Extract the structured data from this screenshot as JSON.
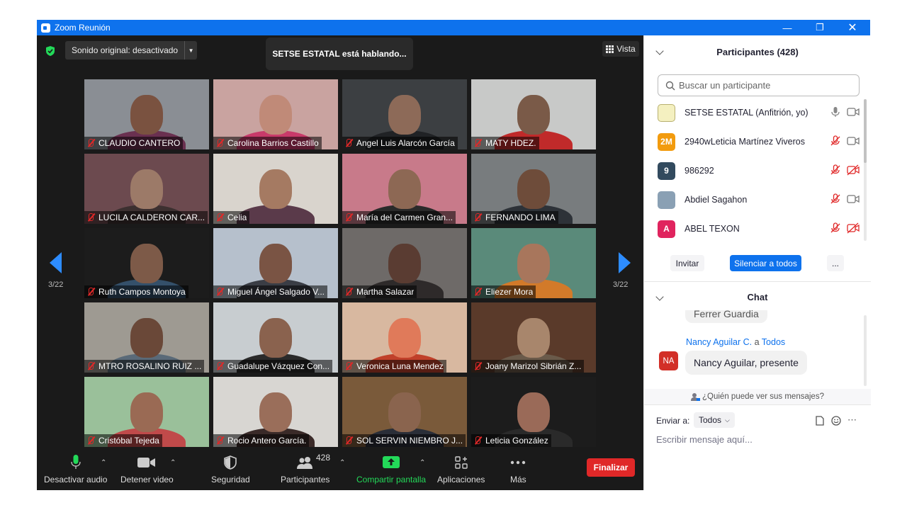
{
  "window": {
    "title": "Zoom Reunión",
    "controls": [
      "minimize",
      "restore",
      "close"
    ]
  },
  "meeting": {
    "original_sound": "Sonido original: desactivado",
    "speaking_banner": "SETSE ESTATAL está hablando...",
    "view_label": "Vista",
    "page_left": "3/22",
    "page_right": "3/22"
  },
  "tiles": [
    {
      "name": "CLAUDIO CANTERO",
      "bg": "#8a8e94",
      "face": "#7a5240",
      "body": "#6a3050"
    },
    {
      "name": "Carolina Barrios Castillo",
      "bg": "#c9a3a0",
      "face": "#c08a78",
      "body": "#c93a6a"
    },
    {
      "name": "Angel Luis Alarcón García",
      "bg": "#3c3f42",
      "face": "#8d6a58",
      "body": "#202225"
    },
    {
      "name": "MATY HDEZ.",
      "bg": "#c8c9c8",
      "face": "#7a5a48",
      "body": "#c02a2a"
    },
    {
      "name": "LUCILA CALDERON CAR...",
      "bg": "#6c4a4f",
      "face": "#9c7a68",
      "body": "#3c3030"
    },
    {
      "name": "Celia",
      "bg": "#d9d4cd",
      "face": "#a57a62",
      "body": "#5a3a4a"
    },
    {
      "name": "María del Carmen  Gran...",
      "bg": "#c87a8a",
      "face": "#8d6854",
      "body": "#2a2a2a"
    },
    {
      "name": "FERNANDO LIMA",
      "bg": "#787c7e",
      "face": "#6e4c3a",
      "body": "#2d3238"
    },
    {
      "name": "Ruth Campos Montoya",
      "bg": "#1c1c1c",
      "face": "#7d5a48",
      "body": "#34506a"
    },
    {
      "name": "Miguel Ángel Salgado V...",
      "bg": "#b6c0cc",
      "face": "#7a5444",
      "body": "#3a3d45"
    },
    {
      "name": "Martha Salazar",
      "bg": "#6e6a68",
      "face": "#5a3c32",
      "body": "#2e2a2a"
    },
    {
      "name": "Eliezer Mora",
      "bg": "#5a8a7a",
      "face": "#a8765c",
      "body": "#d27a2a"
    },
    {
      "name": "MTRO ROSALINO RUIZ ...",
      "bg": "#9e9a92",
      "face": "#6a4838",
      "body": "#5a6a78"
    },
    {
      "name": "Guadalupe Vázquez Con...",
      "bg": "#c8cdd0",
      "face": "#8a624e",
      "body": "#2a2a2a"
    },
    {
      "name": "Veronica Luna Mendez",
      "bg": "#d8b8a0",
      "face": "#e07a5a",
      "body": "#c0402a"
    },
    {
      "name": "Joany Marizol Sibrián Z...",
      "bg": "#5a3a2a",
      "face": "#a8866c",
      "body": "#6a5a4a"
    },
    {
      "name": "Cristóbal Tejeda",
      "bg": "#9ac09a",
      "face": "#9a6a54",
      "body": "#c04a4a"
    },
    {
      "name": "Rocio Antero García.",
      "bg": "#d8d6d2",
      "face": "#9a6e5a",
      "body": "#3a2a28"
    },
    {
      "name": "SOL SERVIN NIEMBRO J...",
      "bg": "#7a5a3a",
      "face": "#8a644e",
      "body": "#2a2e38"
    },
    {
      "name": "Leticia González",
      "bg": "#1c1c1c",
      "face": "#9a6a58",
      "body": "#2a2a2a"
    }
  ],
  "toolbar": {
    "mute": "Desactivar audio",
    "video": "Detener video",
    "security": "Seguridad",
    "participants": "Participantes",
    "participants_count": "428",
    "share": "Compartir pantalla",
    "apps": "Aplicaciones",
    "more": "Más",
    "end": "Finalizar"
  },
  "participants_panel": {
    "title": "Participantes (428)",
    "search_placeholder": "Buscar un participante",
    "list": [
      {
        "name": "SETSE ESTATAL (Anfitrión, yo)",
        "avatar_text": "",
        "avatar_color": "#f4f0c0",
        "mic_muted": false,
        "video_off": false
      },
      {
        "name": "2940wLeticia Martínez Viveros",
        "avatar_text": "2M",
        "avatar_color": "#f29b0e",
        "mic_muted": true,
        "video_off": false
      },
      {
        "name": "986292",
        "avatar_text": "9",
        "avatar_color": "#324a5e",
        "mic_muted": true,
        "video_off": true
      },
      {
        "name": "Abdiel Sagahon",
        "avatar_text": "",
        "avatar_color": "#8aa0b4",
        "mic_muted": true,
        "video_off": false
      },
      {
        "name": "ABEL TEXON",
        "avatar_text": "A",
        "avatar_color": "#e0245e",
        "mic_muted": true,
        "video_off": true
      }
    ],
    "invite": "Invitar",
    "mute_all": "Silenciar a todos",
    "more": "..."
  },
  "chat": {
    "title": "Chat",
    "prev_message": "Ferrer Guardia",
    "sender": "Nancy Aguilar C.",
    "to_word": "a",
    "recipient": "Todos",
    "sender_initials": "NA",
    "message": "Nancy Aguilar, presente",
    "who_can_see": "¿Quién puede ver sus mensajes?",
    "send_to_label": "Enviar a:",
    "send_to_value": "Todos",
    "input_placeholder": "Escribir mensaje aquí..."
  }
}
